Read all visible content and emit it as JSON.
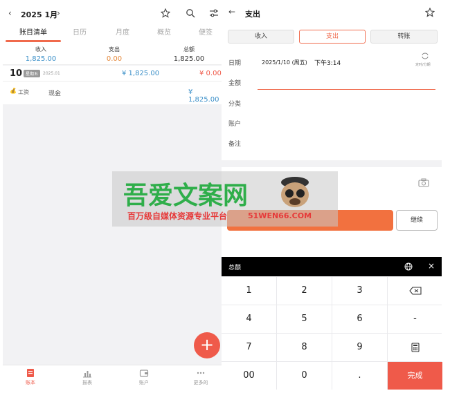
{
  "left": {
    "header": {
      "year_month": "2025 1月"
    },
    "tabs": [
      "账目清单",
      "日历",
      "月度",
      "概览",
      "便签"
    ],
    "summary": [
      {
        "label": "收入",
        "value": "1,825.00",
        "color": "#3a8fc8"
      },
      {
        "label": "支出",
        "value": "0.00",
        "color": "#e5883a"
      },
      {
        "label": "总额",
        "value": "1,825.00",
        "color": "#333333"
      }
    ],
    "day": {
      "date": "10",
      "weekday_badge": "星期五",
      "month": "2025.01",
      "income": "¥ 1,825.00",
      "expense": "¥ 0.00"
    },
    "entry": {
      "emoji": "💰",
      "category": "工资",
      "account": "现金",
      "amount": "¥ 1,825.00"
    },
    "fab": "+",
    "bottom_nav": [
      {
        "label": "账本",
        "icon": "book-icon",
        "active": true
      },
      {
        "label": "报表",
        "icon": "chart-icon",
        "active": false
      },
      {
        "label": "账户",
        "icon": "wallet-icon",
        "active": false
      },
      {
        "label": "更多的",
        "icon": "more-icon",
        "active": false
      }
    ]
  },
  "right": {
    "title": "支出",
    "segments": [
      "收入",
      "支出",
      "转账"
    ],
    "fields": {
      "date_label": "日期",
      "date_value": "2025/1/10 (周五)",
      "time_value": "下午3:14",
      "repeat_label": "定时/分期",
      "amount_label": "金额",
      "category_label": "分类",
      "account_label": "账户",
      "note_label": "备注"
    },
    "save_label": "",
    "continue_label": "继续",
    "keypad_header": "总额",
    "keys": [
      "1",
      "2",
      "3",
      "⌫",
      "4",
      "5",
      "6",
      "-",
      "7",
      "8",
      "9",
      "▦",
      "00",
      "0",
      ".",
      "完成"
    ]
  },
  "watermark": {
    "title": "吾爱文案网",
    "subtitle": "百万级自媒体资源专业平台",
    "url": "51WEN66.COM"
  }
}
